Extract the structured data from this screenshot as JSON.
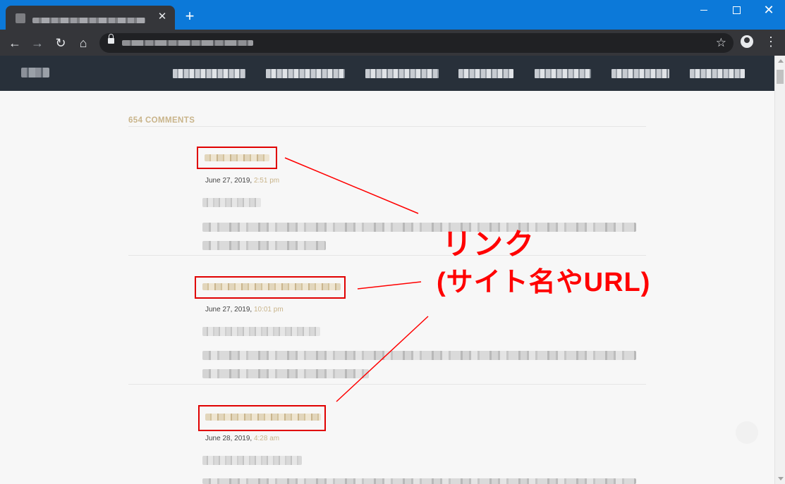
{
  "browser": {
    "tab_close": "✕",
    "new_tab": "+",
    "win_close": "✕"
  },
  "comments": {
    "heading": "654 COMMENTS",
    "items": [
      {
        "date": "June 27, 2019,",
        "time": "2:51 pm"
      },
      {
        "date": "June 27, 2019,",
        "time": "10:01 pm"
      },
      {
        "date": "June 28, 2019,",
        "time": "4:28 am"
      }
    ]
  },
  "annotation": {
    "line1": "リンク",
    "line2": "(サイト名やURL)",
    "color": "#ff0000"
  },
  "colors": {
    "tabbar": "#0c79d9",
    "site_header": "#28303a",
    "accent": "#c9b48a"
  }
}
